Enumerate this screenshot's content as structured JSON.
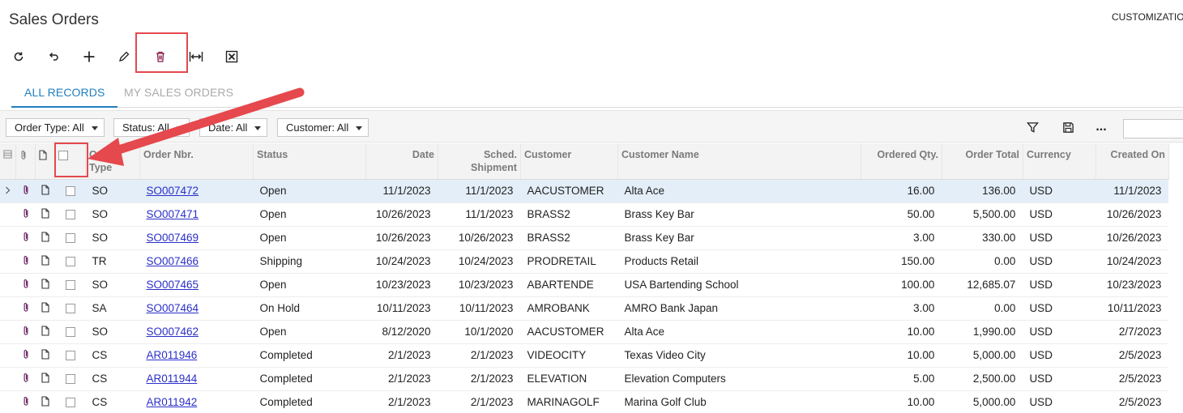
{
  "header": {
    "title": "Sales Orders",
    "customization_label": "CUSTOMIZATIO"
  },
  "toolbar": {
    "buttons": [
      {
        "name": "refresh-icon"
      },
      {
        "name": "undo-icon"
      },
      {
        "name": "add-icon"
      },
      {
        "name": "edit-icon"
      },
      {
        "name": "delete-icon"
      },
      {
        "name": "fit-columns-icon"
      },
      {
        "name": "export-excel-icon"
      }
    ]
  },
  "tabs": [
    {
      "label": "ALL RECORDS",
      "active": true
    },
    {
      "label": "MY SALES ORDERS",
      "active": false
    }
  ],
  "filters": [
    {
      "label": "Order Type: All"
    },
    {
      "label": "Status: All"
    },
    {
      "label": "Date: All"
    },
    {
      "label": "Customer: All"
    }
  ],
  "filter_icons": [
    "filter-icon",
    "save-icon",
    "more-icon"
  ],
  "more_label": "...",
  "search": {
    "value": ""
  },
  "grid": {
    "columns": {
      "order_type": "Order Type",
      "order_nbr": "Order Nbr.",
      "status": "Status",
      "date": "Date",
      "sched_shipment": "Sched. Shipment",
      "customer": "Customer",
      "customer_name": "Customer Name",
      "ordered_qty": "Ordered Qty.",
      "order_total": "Order Total",
      "currency": "Currency",
      "created_on": "Created On"
    },
    "rows": [
      {
        "type": "SO",
        "nbr": "SO007472",
        "status": "Open",
        "date": "11/1/2023",
        "sched": "11/1/2023",
        "customer": "AACUSTOMER",
        "name": "Alta Ace",
        "qty": "16.00",
        "total": "136.00",
        "currency": "USD",
        "created": "11/1/2023",
        "selected": true
      },
      {
        "type": "SO",
        "nbr": "SO007471",
        "status": "Open",
        "date": "10/26/2023",
        "sched": "11/1/2023",
        "customer": "BRASS2",
        "name": "Brass Key Bar",
        "qty": "50.00",
        "total": "5,500.00",
        "currency": "USD",
        "created": "10/26/2023"
      },
      {
        "type": "SO",
        "nbr": "SO007469",
        "status": "Open",
        "date": "10/26/2023",
        "sched": "10/26/2023",
        "customer": "BRASS2",
        "name": "Brass Key Bar",
        "qty": "3.00",
        "total": "330.00",
        "currency": "USD",
        "created": "10/26/2023"
      },
      {
        "type": "TR",
        "nbr": "SO007466",
        "status": "Shipping",
        "date": "10/24/2023",
        "sched": "10/24/2023",
        "customer": "PRODRETAIL",
        "name": "Products Retail",
        "qty": "150.00",
        "total": "0.00",
        "currency": "USD",
        "created": "10/24/2023"
      },
      {
        "type": "SO",
        "nbr": "SO007465",
        "status": "Open",
        "date": "10/23/2023",
        "sched": "10/23/2023",
        "customer": "ABARTENDE",
        "name": "USA Bartending School",
        "qty": "100.00",
        "total": "12,685.07",
        "currency": "USD",
        "created": "10/23/2023"
      },
      {
        "type": "SA",
        "nbr": "SO007464",
        "status": "On Hold",
        "date": "10/11/2023",
        "sched": "10/11/2023",
        "customer": "AMROBANK",
        "name": "AMRO Bank Japan",
        "qty": "3.00",
        "total": "0.00",
        "currency": "USD",
        "created": "10/11/2023"
      },
      {
        "type": "SO",
        "nbr": "SO007462",
        "status": "Open",
        "date": "8/12/2020",
        "sched": "10/1/2020",
        "customer": "AACUSTOMER",
        "name": "Alta Ace",
        "qty": "10.00",
        "total": "1,990.00",
        "currency": "USD",
        "created": "2/7/2023"
      },
      {
        "type": "CS",
        "nbr": "AR011946",
        "status": "Completed",
        "date": "2/1/2023",
        "sched": "2/1/2023",
        "customer": "VIDEOCITY",
        "name": "Texas Video City",
        "qty": "10.00",
        "total": "5,000.00",
        "currency": "USD",
        "created": "2/5/2023"
      },
      {
        "type": "CS",
        "nbr": "AR011944",
        "status": "Completed",
        "date": "2/1/2023",
        "sched": "2/1/2023",
        "customer": "ELEVATION",
        "name": "Elevation Computers",
        "qty": "5.00",
        "total": "2,500.00",
        "currency": "USD",
        "created": "2/5/2023"
      },
      {
        "type": "CS",
        "nbr": "AR011942",
        "status": "Completed",
        "date": "2/1/2023",
        "sched": "2/1/2023",
        "customer": "MARINAGOLF",
        "name": "Marina Golf Club",
        "qty": "10.00",
        "total": "5,000.00",
        "currency": "USD",
        "created": "2/5/2023"
      }
    ]
  },
  "colors": {
    "accent": "#1f7fc1",
    "highlight": "#e5484d",
    "link": "#2a2fc9",
    "selected_row": "#e3eef8"
  }
}
